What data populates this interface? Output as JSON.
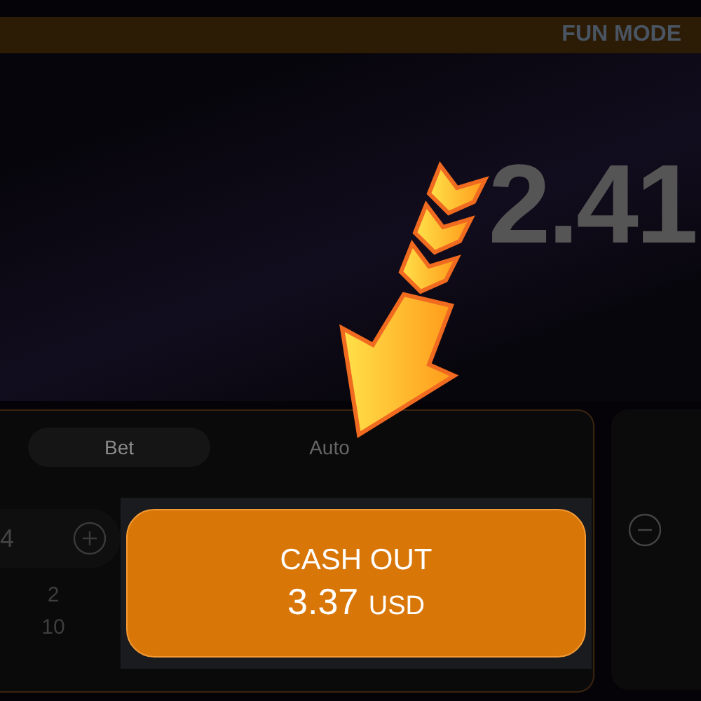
{
  "header": {
    "mode_label": "FUN MODE"
  },
  "game": {
    "multiplier": "2.41"
  },
  "bet_panel": {
    "tabs": [
      {
        "label": "Bet",
        "selected": true
      },
      {
        "label": "Auto",
        "selected": false
      }
    ],
    "amount": "4",
    "quick_amounts": [
      "2",
      "10"
    ],
    "cash_out": {
      "label": "CASH OUT",
      "amount": "3.37",
      "currency": "USD"
    }
  }
}
